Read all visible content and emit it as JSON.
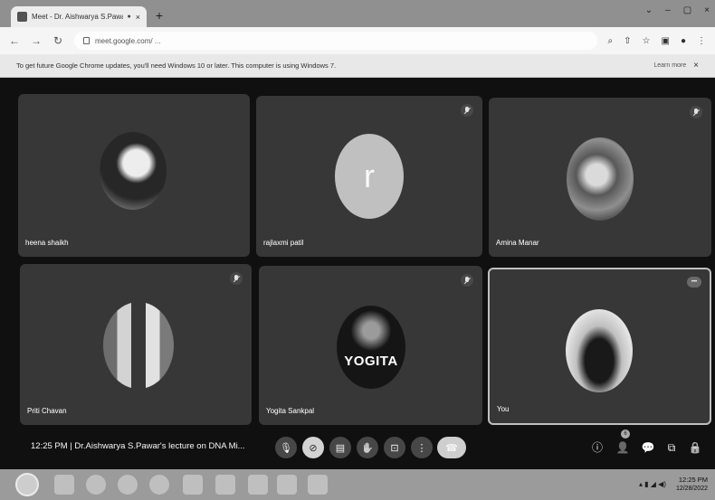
{
  "browser": {
    "tab_title": "Meet - Dr. Aishwarya S.Pawar",
    "tab_recording_indicator": "●",
    "tab_close": "×",
    "new_tab": "+",
    "window_controls": [
      "⌄",
      "–",
      "▢",
      "×"
    ],
    "url": "meet.google.com/ ... ",
    "toolbar_icons": [
      "⌕",
      "⇧",
      "☆",
      "▣",
      "●",
      "⋮"
    ]
  },
  "infobar": {
    "message": "To get future Google Chrome updates, you'll need Windows 10 or later. This computer is using Windows 7.",
    "learn_more": "Learn more",
    "close": "×"
  },
  "participants": [
    {
      "name": "heena shaikh",
      "muted": false,
      "avatar": "photo"
    },
    {
      "name": "rajlaxmi patil",
      "muted": true,
      "avatar": "letter",
      "letter": "r"
    },
    {
      "name": "Amina Manar",
      "muted": true,
      "avatar": "photo"
    },
    {
      "name": "Priti Chavan",
      "muted": true,
      "avatar": "photo"
    },
    {
      "name": "Yogita Sankpal",
      "muted": true,
      "avatar": "logo",
      "logo_text": "YOGITA"
    },
    {
      "name": "You",
      "muted": false,
      "avatar": "photo",
      "badge": "•••"
    }
  ],
  "bottombar": {
    "time": "12:25 PM",
    "separator": "|",
    "meeting_title": "Dr.Aishwarya S.Pawar's lecture on DNA Mi...",
    "people_count": "6"
  },
  "taskbar": {
    "tray_icons": "▴  ▮  ◢  ◀)",
    "time": "12:25 PM",
    "date": "12/28/2022"
  },
  "colors": {
    "meet_background": "#151515",
    "tile": "#3a3a3a",
    "end_call": "#cacaca"
  }
}
